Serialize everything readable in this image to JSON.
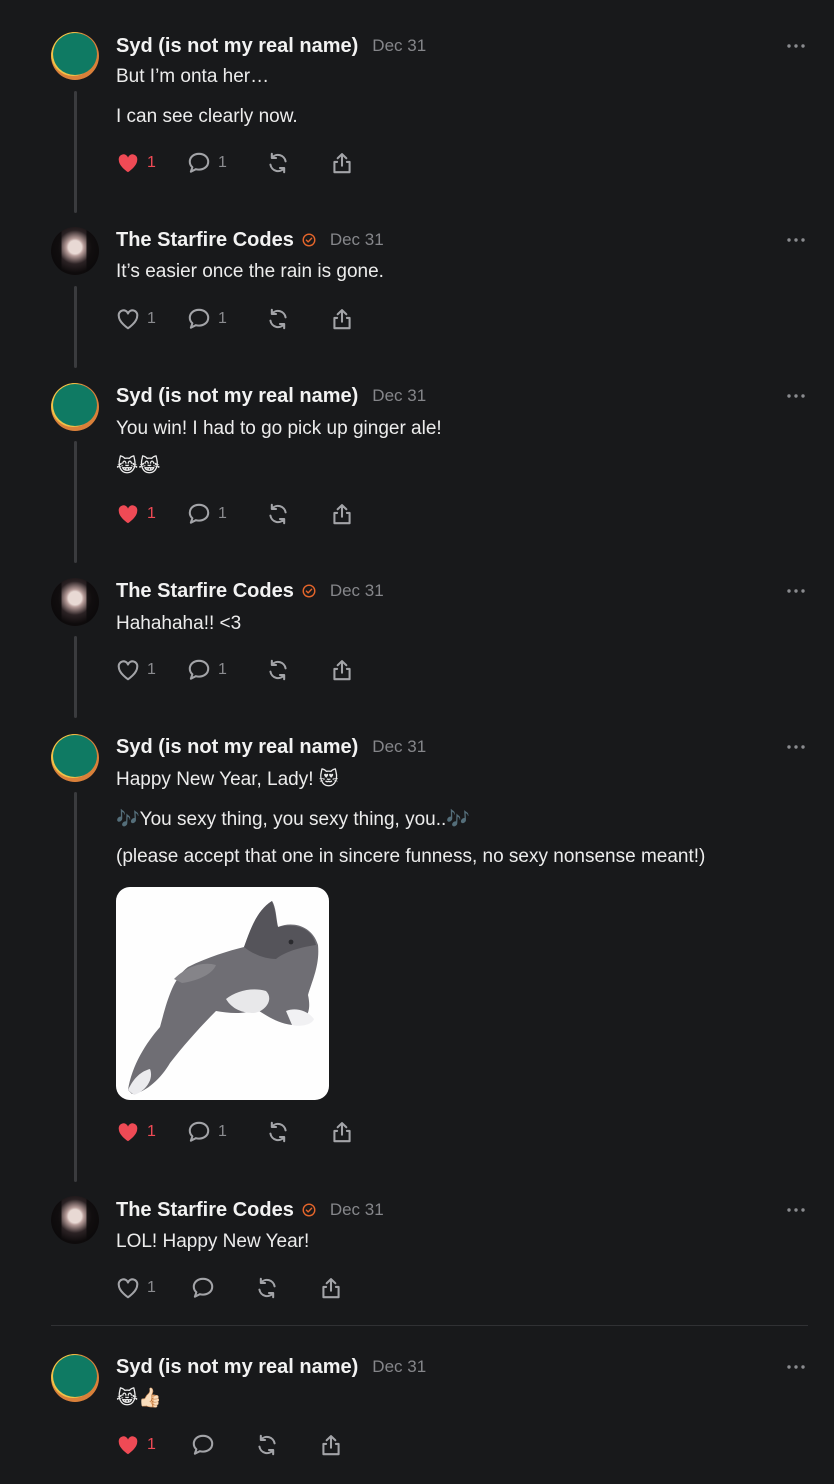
{
  "posts": [
    {
      "author": "Syd (is not my real name)",
      "date": "Dec 31",
      "lines": [
        "But I’m onta her…",
        "I can see clearly now."
      ],
      "likes": "1",
      "comments": "1",
      "liked": true
    },
    {
      "author": "The Starfire Codes",
      "date": "Dec 31",
      "verified": true,
      "lines": [
        "It’s easier once the rain is gone."
      ],
      "likes": "1",
      "comments": "1",
      "liked": false
    },
    {
      "author": "Syd (is not my real name)",
      "date": "Dec 31",
      "lines": [
        "You win! I had to go pick up ginger ale!",
        "😹😹"
      ],
      "likes": "1",
      "comments": "1",
      "liked": true
    },
    {
      "author": "The Starfire Codes",
      "date": "Dec 31",
      "verified": true,
      "lines": [
        "Hahahaha!! <3"
      ],
      "likes": "1",
      "comments": "1",
      "liked": false
    },
    {
      "author": "Syd (is not my real name)",
      "date": "Dec 31",
      "lines": [
        "Happy New Year, Lady! 😻",
        "🎶You sexy thing, you sexy thing, you..🎶",
        "(please accept that one in sincere funness, no sexy nonsense meant!)"
      ],
      "image": "cat-photo",
      "likes": "1",
      "comments": "1",
      "liked": true
    },
    {
      "author": "The Starfire Codes",
      "date": "Dec 31",
      "verified": true,
      "lines": [
        "LOL! Happy New Year!"
      ],
      "likes": "1",
      "comments": "",
      "liked": false
    },
    {
      "author": "Syd (is not my real name)",
      "date": "Dec 31",
      "lines": [
        "😹👍🏻"
      ],
      "likes": "1",
      "comments": "",
      "liked": true
    }
  ],
  "icons": {
    "like": "heart-icon",
    "comment": "comment-icon",
    "repost": "repost-icon",
    "share": "share-icon",
    "more": "more-options-icon",
    "verified": "verified-badge-icon"
  },
  "colors": {
    "background": "#18191b",
    "liked": "#ef4a55",
    "verified": "#e5662b",
    "muted": "#85868a",
    "text": "#ececec"
  }
}
